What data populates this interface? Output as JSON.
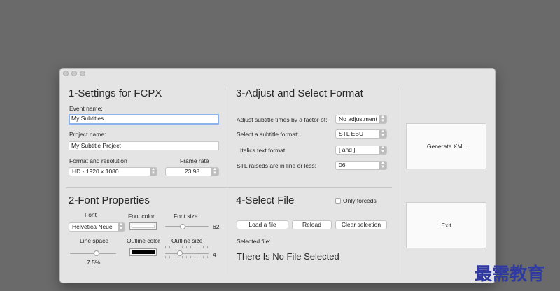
{
  "settings": {
    "heading": "1-Settings for FCPX",
    "event_label": "Event name:",
    "event_value": "My Subtitles",
    "project_label": "Project name:",
    "project_value": "My Subtitle Project",
    "format_label": "Format and resolution",
    "format_value": "HD - 1920 x 1080",
    "framerate_label": "Frame rate",
    "framerate_value": "23.98"
  },
  "adjust": {
    "heading": "3-Adjust and Select Format",
    "factor_label": "Adjust subtitle times by a factor of:",
    "factor_value": "No adjustment",
    "format_label": "Select a subtitle format:",
    "format_value": "STL EBU",
    "italics_label": "Italics text format",
    "italics_value": "[ and ]",
    "stl_label": "STL raiseds are in line or less:",
    "stl_value": "06"
  },
  "font": {
    "heading": "2-Font Properties",
    "font_label": "Font",
    "font_value": "Helvetica Neue",
    "color_label": "Font color",
    "font_color": "#ffffff",
    "size_label": "Font size",
    "size_value": "62",
    "linespace_label": "Line space",
    "linespace_value": "7.5%",
    "outline_color_label": "Outline color",
    "outline_color": "#000000",
    "outline_size_label": "Outline size",
    "outline_size_value": "4"
  },
  "select_file": {
    "heading": "4-Select File",
    "only_forceds_label": "Only forceds",
    "only_forceds_checked": false,
    "load_label": "Load a file",
    "reload_label": "Reload",
    "clear_label": "Clear selection",
    "selected_label": "Selected file:",
    "status": "There Is No File Selected"
  },
  "actions": {
    "generate_label": "Generate XML",
    "exit_label": "Exit"
  },
  "watermark": "最需教育"
}
